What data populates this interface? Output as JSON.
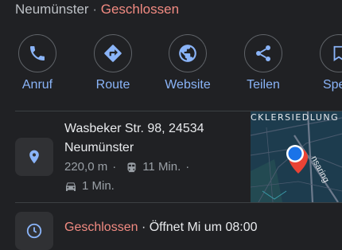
{
  "header": {
    "city": "Neumünster",
    "separator": "·",
    "status": "Geschlossen"
  },
  "actions": [
    {
      "label": "Anruf",
      "icon": "phone-icon"
    },
    {
      "label": "Route",
      "icon": "directions-icon"
    },
    {
      "label": "Website",
      "icon": "globe-icon"
    },
    {
      "label": "Teilen",
      "icon": "share-icon"
    },
    {
      "label": "Speic",
      "icon": "bookmark-icon"
    }
  ],
  "address": {
    "line1": "Wasbeker Str. 98, 24534",
    "line2": "Neumünster",
    "distance": "220,0 m",
    "transit_time": "11 Min.",
    "drive_time": "1 Min."
  },
  "map": {
    "area_label": "CKLERSIEDLUNG",
    "road_label": "nsaring"
  },
  "hours": {
    "status": "Geschlossen",
    "detail": "· Öffnet Mi um 08:00"
  },
  "colors": {
    "background": "#202124",
    "accent": "#8ab4f8",
    "closed": "#f28b82",
    "pin": "#ea4335",
    "location_dot": "#1a73e8"
  }
}
